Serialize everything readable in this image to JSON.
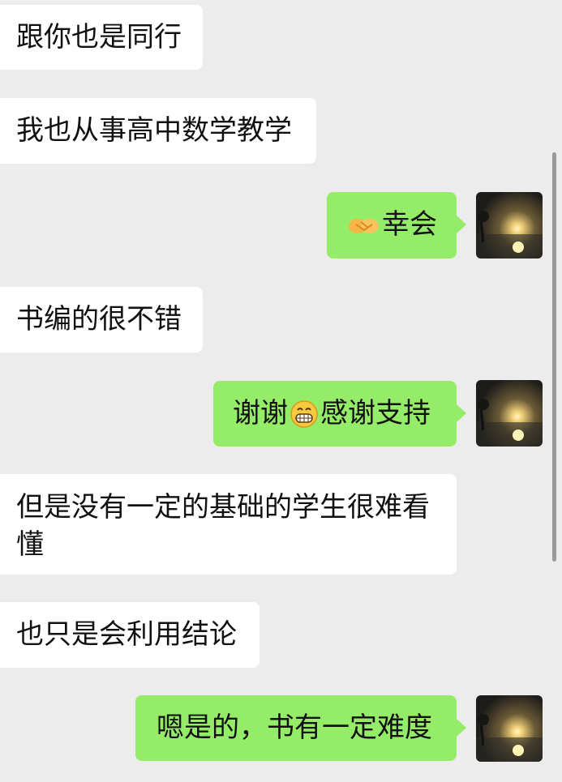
{
  "messages": [
    {
      "side": "in",
      "text": "跟你也是同行"
    },
    {
      "side": "in",
      "text": "我也从事高中数学教学"
    },
    {
      "side": "out",
      "emoji": "handshake-emoji",
      "text": "幸会"
    },
    {
      "side": "in",
      "text": "书编的很不错"
    },
    {
      "side": "out",
      "text_before": "谢谢",
      "emoji": "grin-emoji",
      "text_after": "感谢支持"
    },
    {
      "side": "in",
      "text": "但是没有一定的基础的学生很难看懂"
    },
    {
      "side": "in",
      "text": "也只是会利用结论"
    },
    {
      "side": "out",
      "text": "嗯是的，书有一定难度"
    }
  ],
  "colors": {
    "background": "#ececec",
    "incoming_bubble": "#ffffff",
    "outgoing_bubble": "#95ec69"
  },
  "avatar": {
    "icon": "sunset-landscape-avatar"
  }
}
